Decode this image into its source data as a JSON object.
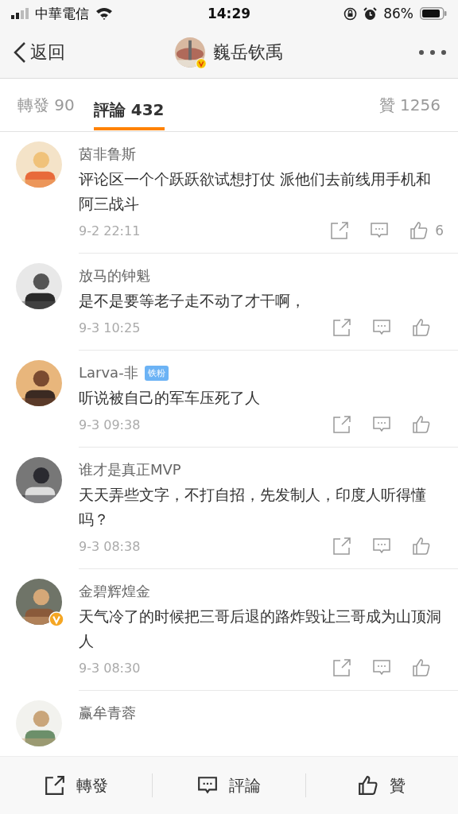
{
  "status_bar": {
    "carrier": "中華電信",
    "time": "14:29",
    "battery": "86%"
  },
  "nav": {
    "back": "返回",
    "title": "巍岳钦禹",
    "verified": true
  },
  "tabs": [
    {
      "label": "轉發 90",
      "selected": false
    },
    {
      "label": "評論 432",
      "selected": true
    },
    {
      "label": "贊 1256",
      "selected": false
    }
  ],
  "comments": [
    {
      "name": "茵非鲁斯",
      "verified": false,
      "text": "评论区一个个跃跃欲试想打仗 派他们去前线用手机和阿三战斗",
      "time": "9-2 22:11",
      "likes": "6"
    },
    {
      "name": "放马的钟魁",
      "verified": false,
      "text": "是不是要等老子走不动了才干啊，",
      "time": "9-3 10:25"
    },
    {
      "name": "Larva-非",
      "badge": "铁粉",
      "verified": false,
      "text": "听说被自己的军车压死了人",
      "time": "9-3 09:38"
    },
    {
      "name": "谁才是真正MVP",
      "verified": false,
      "text": "天天弄些文字，不打自招，先发制人，印度人听得懂吗？",
      "time": "9-3 08:38"
    },
    {
      "name": "金碧辉煌金",
      "verified": true,
      "text": "天气冷了的时候把三哥后退的路炸毁让三哥成为山顶洞人",
      "time": "9-3 08:30"
    },
    {
      "name": "赢牟青蓉",
      "verified": false
    }
  ],
  "bottom_bar": [
    "轉發",
    "評論",
    "贊"
  ]
}
